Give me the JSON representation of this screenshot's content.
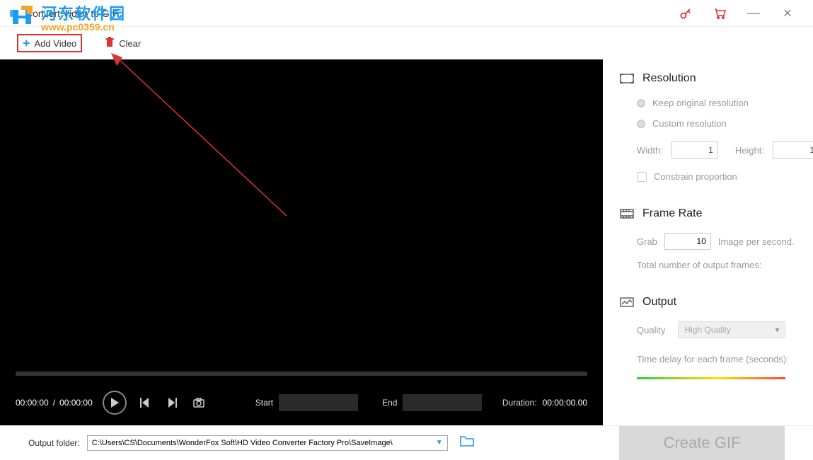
{
  "titlebar": {
    "app_title": "Convert Video to GIF"
  },
  "toolbar": {
    "add_video_label": "Add Video",
    "clear_label": "Clear"
  },
  "controls": {
    "current_time": "00:00:00",
    "total_time": "00:00:00",
    "start_label": "Start",
    "start_value": "",
    "end_label": "End",
    "end_value": "",
    "duration_label": "Duration:",
    "duration_value": "00:00:00.00"
  },
  "resolution": {
    "title": "Resolution",
    "keep_original_label": "Keep original resolution",
    "custom_label": "Custom resolution",
    "width_label": "Width:",
    "width_value": "1",
    "height_label": "Height:",
    "height_value": "1",
    "constrain_label": "Constrain proportion"
  },
  "framerate": {
    "title": "Frame Rate",
    "grab_label": "Grab",
    "grab_value": "10",
    "grab_suffix": "Image per second.",
    "total_label": "Total number of output frames:"
  },
  "output": {
    "title": "Output",
    "quality_label": "Quality",
    "quality_value": "High Quality",
    "delay_label": "Time delay for each frame (seconds):"
  },
  "footer": {
    "output_folder_label": "Output folder:",
    "output_folder_value": "C:\\Users\\CS\\Documents\\WonderFox Soft\\HD Video Converter Factory Pro\\SaveImage\\",
    "create_button_label": "Create GIF"
  },
  "watermark": {
    "chinese": "河东软件园",
    "url": "www.pc0359.cn"
  }
}
